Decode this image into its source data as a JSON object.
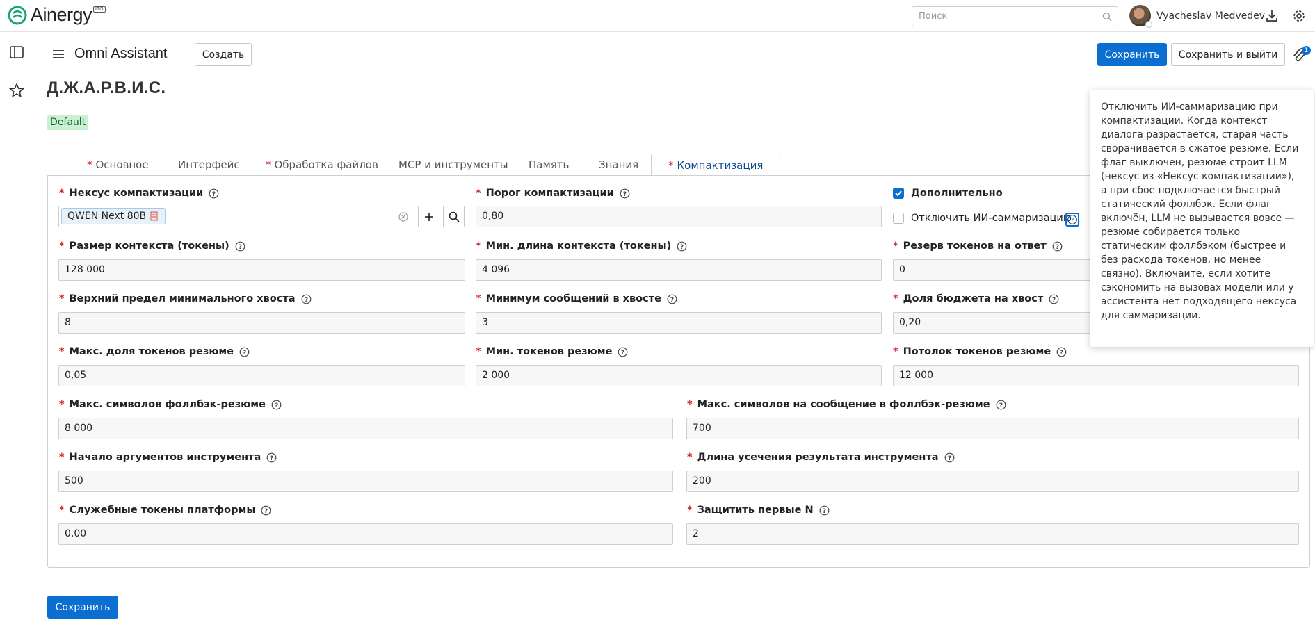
{
  "app": {
    "logo_text": "Ainergy",
    "logo_badge": "ITG"
  },
  "search": {
    "placeholder": "Поиск"
  },
  "user": {
    "name": "Vyacheslav Medvedev"
  },
  "header": {
    "title": "Omni Assistant",
    "create_label": "Создать",
    "save_label": "Сохранить",
    "save_exit_label": "Сохранить и выйти",
    "attachments_count": "1"
  },
  "record": {
    "title": "Д.Ж.А.Р.В.И.С.",
    "tag": "Default"
  },
  "tabs": [
    {
      "label": "Основное",
      "required": true
    },
    {
      "label": "Интерфейс",
      "required": false
    },
    {
      "label": "Обработка файлов",
      "required": true
    },
    {
      "label": "MCP и инструменты",
      "required": false
    },
    {
      "label": "Память",
      "required": false
    },
    {
      "label": "Знания",
      "required": false
    },
    {
      "label": "Компактизация",
      "required": true,
      "active": true
    }
  ],
  "form": {
    "nexus": {
      "label": "Нексус компактизации",
      "value": "QWEN Next 80B"
    },
    "threshold": {
      "label": "Порог компактизации",
      "value": "0,80"
    },
    "extra": {
      "label": "Дополнительно",
      "checked": true
    },
    "disable_ai": {
      "label": "Отключить ИИ-саммаризацию",
      "checked": false
    },
    "context_size": {
      "label": "Размер контекста (токены)",
      "value": "128 000"
    },
    "min_context": {
      "label": "Мин. длина контекста (токены)",
      "value": "4 096"
    },
    "reserve": {
      "label": "Резерв токенов на ответ",
      "value": "0"
    },
    "tail_upper": {
      "label": "Верхний предел минимального хвоста",
      "value": "8"
    },
    "tail_min_msgs": {
      "label": "Минимум сообщений в хвосте",
      "value": "3"
    },
    "tail_budget": {
      "label": "Доля бюджета на хвост",
      "value": "0,20"
    },
    "summary_max_share": {
      "label": "Макс. доля токенов резюме",
      "value": "0,05"
    },
    "summary_min_tokens": {
      "label": "Мин. токенов резюме",
      "value": "2 000"
    },
    "summary_ceiling": {
      "label": "Потолок токенов резюме",
      "value": "12 000"
    },
    "fallback_max_chars": {
      "label": "Макс. символов фоллбэк-резюме",
      "value": "8 000"
    },
    "fallback_msg_chars": {
      "label": "Макс. символов на сообщение в фоллбэк-резюме",
      "value": "700"
    },
    "tool_args_start": {
      "label": "Начало аргументов инструмента",
      "value": "500"
    },
    "tool_result_trunc": {
      "label": "Длина усечения результата инструмента",
      "value": "200"
    },
    "platform_tokens": {
      "label": "Служебные токены платформы",
      "value": "0,00"
    },
    "protect_first": {
      "label": "Защитить первые N",
      "value": "2"
    }
  },
  "tooltip": {
    "text": "Отключить ИИ-саммаризацию при компактизации. Когда контекст диалога разрастается, старая часть сворачивается в сжатое резюме. Если флаг выключен, резюме строит LLM (нексус из «Нексус компактизации»), а при сбое подключается быстрый статический фоллбэк. Если флаг включён, LLM не вызывается вовсе — резюме собирается только статическим фоллбэком (быстрее и без расхода токенов, но менее связно). Включайте, если хотите сэкономить на вызовах модели или у ассистента нет подходящего нексуса для саммаризации."
  },
  "footer": {
    "save_label": "Сохранить"
  },
  "colors": {
    "primary": "#0a6fd1",
    "required": "#d0252c",
    "tag_bg": "#c8f0d2",
    "logo": "#1aa37a"
  }
}
